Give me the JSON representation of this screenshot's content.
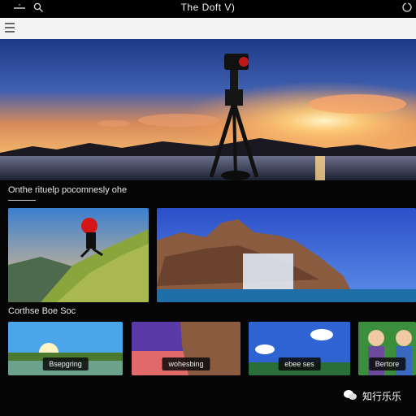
{
  "window": {
    "title": "The Doft V)",
    "icons": [
      "menu-lines-icon",
      "search-icon",
      "power-icon"
    ]
  },
  "sections": {
    "section1_title": "Onthe rituelp pocomnesly ohe",
    "section2_title": "Corthse Boe Soc"
  },
  "thumbnails": [
    {
      "label": "Bsepgring"
    },
    {
      "label": "wohesbing"
    },
    {
      "label": "ebee ses"
    },
    {
      "label": "Bertore"
    }
  ],
  "watermark": {
    "text": "知行乐乐"
  },
  "colors": {
    "background": "#050505",
    "topbar": "#000000",
    "urlbar": "#f4f4f4"
  }
}
